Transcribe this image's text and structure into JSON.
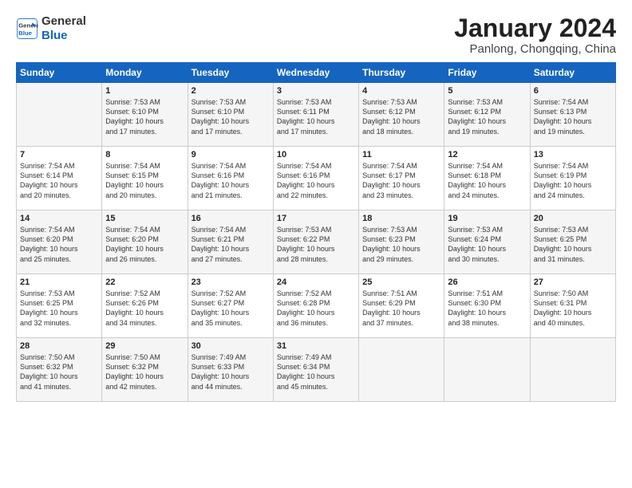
{
  "header": {
    "logo_line1": "General",
    "logo_line2": "Blue",
    "month": "January 2024",
    "location": "Panlong, Chongqing, China"
  },
  "weekdays": [
    "Sunday",
    "Monday",
    "Tuesday",
    "Wednesday",
    "Thursday",
    "Friday",
    "Saturday"
  ],
  "weeks": [
    [
      {
        "day": "",
        "info": ""
      },
      {
        "day": "1",
        "info": "Sunrise: 7:53 AM\nSunset: 6:10 PM\nDaylight: 10 hours\nand 17 minutes."
      },
      {
        "day": "2",
        "info": "Sunrise: 7:53 AM\nSunset: 6:10 PM\nDaylight: 10 hours\nand 17 minutes."
      },
      {
        "day": "3",
        "info": "Sunrise: 7:53 AM\nSunset: 6:11 PM\nDaylight: 10 hours\nand 17 minutes."
      },
      {
        "day": "4",
        "info": "Sunrise: 7:53 AM\nSunset: 6:12 PM\nDaylight: 10 hours\nand 18 minutes."
      },
      {
        "day": "5",
        "info": "Sunrise: 7:53 AM\nSunset: 6:12 PM\nDaylight: 10 hours\nand 19 minutes."
      },
      {
        "day": "6",
        "info": "Sunrise: 7:54 AM\nSunset: 6:13 PM\nDaylight: 10 hours\nand 19 minutes."
      }
    ],
    [
      {
        "day": "7",
        "info": "Sunrise: 7:54 AM\nSunset: 6:14 PM\nDaylight: 10 hours\nand 20 minutes."
      },
      {
        "day": "8",
        "info": "Sunrise: 7:54 AM\nSunset: 6:15 PM\nDaylight: 10 hours\nand 20 minutes."
      },
      {
        "day": "9",
        "info": "Sunrise: 7:54 AM\nSunset: 6:16 PM\nDaylight: 10 hours\nand 21 minutes."
      },
      {
        "day": "10",
        "info": "Sunrise: 7:54 AM\nSunset: 6:16 PM\nDaylight: 10 hours\nand 22 minutes."
      },
      {
        "day": "11",
        "info": "Sunrise: 7:54 AM\nSunset: 6:17 PM\nDaylight: 10 hours\nand 23 minutes."
      },
      {
        "day": "12",
        "info": "Sunrise: 7:54 AM\nSunset: 6:18 PM\nDaylight: 10 hours\nand 24 minutes."
      },
      {
        "day": "13",
        "info": "Sunrise: 7:54 AM\nSunset: 6:19 PM\nDaylight: 10 hours\nand 24 minutes."
      }
    ],
    [
      {
        "day": "14",
        "info": "Sunrise: 7:54 AM\nSunset: 6:20 PM\nDaylight: 10 hours\nand 25 minutes."
      },
      {
        "day": "15",
        "info": "Sunrise: 7:54 AM\nSunset: 6:20 PM\nDaylight: 10 hours\nand 26 minutes."
      },
      {
        "day": "16",
        "info": "Sunrise: 7:54 AM\nSunset: 6:21 PM\nDaylight: 10 hours\nand 27 minutes."
      },
      {
        "day": "17",
        "info": "Sunrise: 7:53 AM\nSunset: 6:22 PM\nDaylight: 10 hours\nand 28 minutes."
      },
      {
        "day": "18",
        "info": "Sunrise: 7:53 AM\nSunset: 6:23 PM\nDaylight: 10 hours\nand 29 minutes."
      },
      {
        "day": "19",
        "info": "Sunrise: 7:53 AM\nSunset: 6:24 PM\nDaylight: 10 hours\nand 30 minutes."
      },
      {
        "day": "20",
        "info": "Sunrise: 7:53 AM\nSunset: 6:25 PM\nDaylight: 10 hours\nand 31 minutes."
      }
    ],
    [
      {
        "day": "21",
        "info": "Sunrise: 7:53 AM\nSunset: 6:25 PM\nDaylight: 10 hours\nand 32 minutes."
      },
      {
        "day": "22",
        "info": "Sunrise: 7:52 AM\nSunset: 6:26 PM\nDaylight: 10 hours\nand 34 minutes."
      },
      {
        "day": "23",
        "info": "Sunrise: 7:52 AM\nSunset: 6:27 PM\nDaylight: 10 hours\nand 35 minutes."
      },
      {
        "day": "24",
        "info": "Sunrise: 7:52 AM\nSunset: 6:28 PM\nDaylight: 10 hours\nand 36 minutes."
      },
      {
        "day": "25",
        "info": "Sunrise: 7:51 AM\nSunset: 6:29 PM\nDaylight: 10 hours\nand 37 minutes."
      },
      {
        "day": "26",
        "info": "Sunrise: 7:51 AM\nSunset: 6:30 PM\nDaylight: 10 hours\nand 38 minutes."
      },
      {
        "day": "27",
        "info": "Sunrise: 7:50 AM\nSunset: 6:31 PM\nDaylight: 10 hours\nand 40 minutes."
      }
    ],
    [
      {
        "day": "28",
        "info": "Sunrise: 7:50 AM\nSunset: 6:32 PM\nDaylight: 10 hours\nand 41 minutes."
      },
      {
        "day": "29",
        "info": "Sunrise: 7:50 AM\nSunset: 6:32 PM\nDaylight: 10 hours\nand 42 minutes."
      },
      {
        "day": "30",
        "info": "Sunrise: 7:49 AM\nSunset: 6:33 PM\nDaylight: 10 hours\nand 44 minutes."
      },
      {
        "day": "31",
        "info": "Sunrise: 7:49 AM\nSunset: 6:34 PM\nDaylight: 10 hours\nand 45 minutes."
      },
      {
        "day": "",
        "info": ""
      },
      {
        "day": "",
        "info": ""
      },
      {
        "day": "",
        "info": ""
      }
    ]
  ]
}
